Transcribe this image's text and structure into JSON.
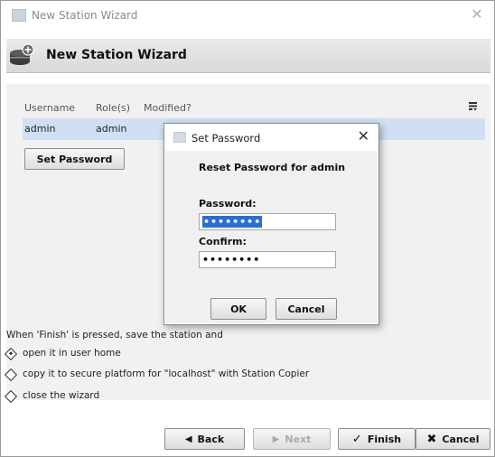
{
  "window": {
    "title": "New Station Wizard",
    "close_glyph": "✕"
  },
  "header": {
    "title": "New Station Wizard",
    "icon": "station-database-icon"
  },
  "table": {
    "columns": [
      "Username",
      "Role(s)",
      "Modified?"
    ],
    "rows": [
      {
        "username": "admin",
        "roles": "admin",
        "modified": ""
      }
    ]
  },
  "set_password_button": "Set Password",
  "options": {
    "intro": "When 'Finish' is pressed, save the station and",
    "items": [
      {
        "label": "open it in user home",
        "selected": true
      },
      {
        "label": "copy it to secure platform for \"localhost\" with Station Copier",
        "selected": false
      },
      {
        "label": "close the wizard",
        "selected": false
      }
    ]
  },
  "footer": {
    "back": "Back",
    "next": "Next",
    "finish": "Finish",
    "cancel": "Cancel"
  },
  "dialog": {
    "title": "Set Password",
    "close_glyph": "✕",
    "heading": "Reset Password for admin",
    "password_label": "Password:",
    "password_value": "••••••••",
    "confirm_label": "Confirm:",
    "confirm_value": "••••••••",
    "ok": "OK",
    "cancel": "Cancel"
  },
  "colors": {
    "selection": "#cfe0f4",
    "text_selection": "#2b6ed1"
  }
}
